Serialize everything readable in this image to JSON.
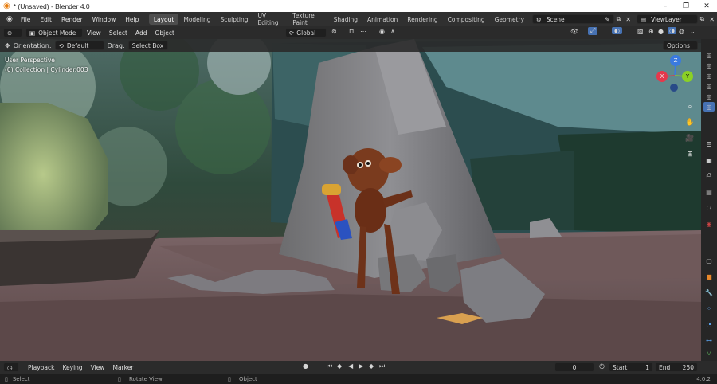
{
  "window": {
    "title": "* (Unsaved) - Blender 4.0",
    "minimize": "–",
    "maximize": "❐",
    "close": "✕"
  },
  "menu": {
    "items": [
      "File",
      "Edit",
      "Render",
      "Window",
      "Help"
    ]
  },
  "workspaces": [
    "Layout",
    "Modeling",
    "Sculpting",
    "UV Editing",
    "Texture Paint",
    "Shading",
    "Animation",
    "Rendering",
    "Compositing",
    "Geometry"
  ],
  "scene": {
    "name": "Scene",
    "viewlayer": "ViewLayer"
  },
  "header3d": {
    "mode": "Object Mode",
    "view": "View",
    "select": "Select",
    "add": "Add",
    "object": "Object",
    "transform_orientation": "Global"
  },
  "tooloptions": {
    "orientation_label": "Orientation:",
    "orientation_value": "Default",
    "drag_label": "Drag:",
    "drag_value": "Select Box",
    "options": "Options"
  },
  "viewport": {
    "perspective": "User Perspective",
    "collection": "(0) Collection | Cylinder.003"
  },
  "gizmo": {
    "x": "X",
    "y": "Y",
    "z": "Z"
  },
  "timeline": {
    "playback": "Playback",
    "keying": "Keying",
    "view": "View",
    "marker": "Marker",
    "current_frame": "0",
    "start_label": "Start",
    "start": "1",
    "end_label": "End",
    "end": "250"
  },
  "status": {
    "select": "Select",
    "rotate": "Rotate View",
    "object": "Object",
    "version": "4.0.2"
  },
  "colors": {
    "accent": "#4772b3",
    "active_ws": "#4d4d4d",
    "x_axis": "#e5384c",
    "y_axis": "#8bd125",
    "z_axis": "#3a7ae0"
  }
}
